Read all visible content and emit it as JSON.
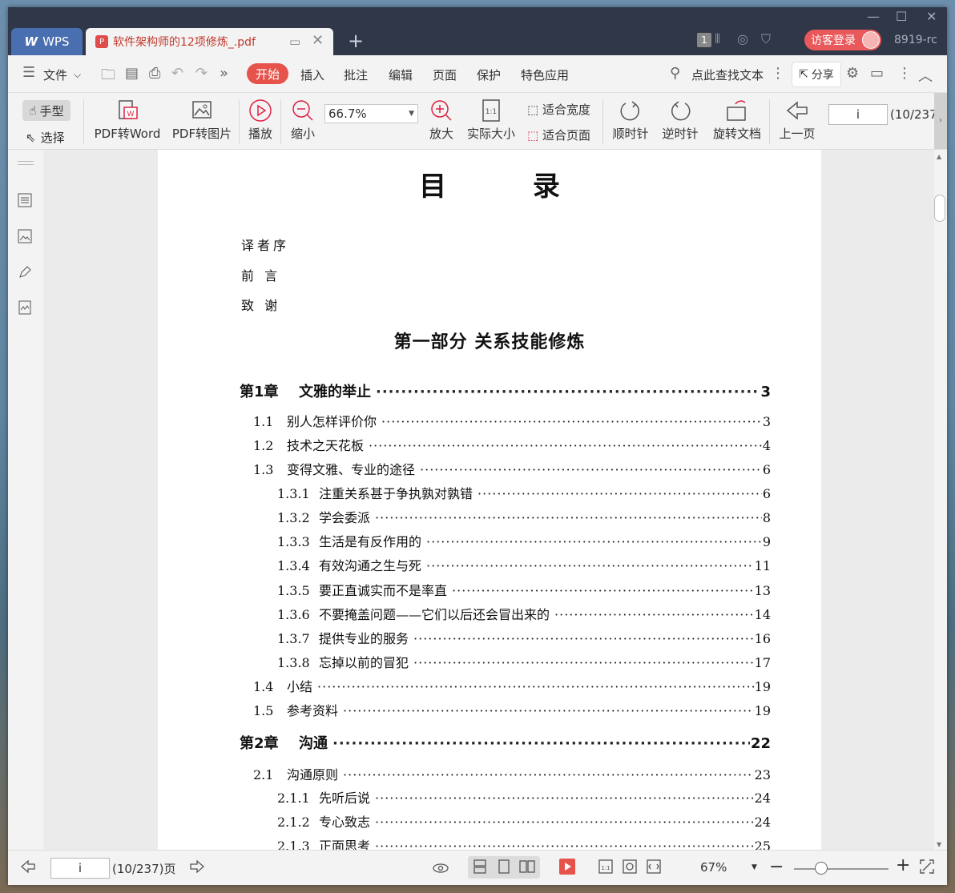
{
  "app": {
    "app_tab": "WPS",
    "doc_tab": "软件架构师的12项修炼_.pdf",
    "login": "访客登录",
    "version": "8919-rc",
    "window_count": "1"
  },
  "menu": {
    "file": "文件",
    "items": [
      "开始",
      "插入",
      "批注",
      "编辑",
      "页面",
      "保护",
      "特色应用"
    ],
    "search": "点此查找文本",
    "share": "分享"
  },
  "ribbon": {
    "hand": "手型",
    "select": "选择",
    "pdf_to_word": "PDF转Word",
    "pdf_to_image": "PDF转图片",
    "play": "播放",
    "zoom_out": "缩小",
    "zoom_value": "66.7%",
    "zoom_in": "放大",
    "actual_size": "实际大小",
    "fit_width": "适合宽度",
    "fit_page": "适合页面",
    "clockwise": "顺时针",
    "counterclockwise": "逆时针",
    "rotate_doc": "旋转文档",
    "prev_page": "上一页",
    "page_input": "i",
    "page_total": "(10/237"
  },
  "document": {
    "title": "目 录",
    "front_matter": [
      "译者序",
      "前 言",
      "致 谢"
    ],
    "part_title": "第一部分 关系技能修炼",
    "toc": [
      {
        "level": 1,
        "num": "第1章",
        "text": "文雅的举止",
        "page": "3"
      },
      {
        "level": 2,
        "num": "1.1",
        "text": "别人怎样评价你",
        "page": "3"
      },
      {
        "level": 2,
        "num": "1.2",
        "text": "技术之天花板",
        "page": "4"
      },
      {
        "level": 2,
        "num": "1.3",
        "text": "变得文雅、专业的途径",
        "page": "6"
      },
      {
        "level": 3,
        "num": "1.3.1",
        "text": "注重关系甚于争执孰对孰错",
        "page": "6"
      },
      {
        "level": 3,
        "num": "1.3.2",
        "text": "学会委派",
        "page": "8"
      },
      {
        "level": 3,
        "num": "1.3.3",
        "text": "生活是有反作用的",
        "page": "9"
      },
      {
        "level": 3,
        "num": "1.3.4",
        "text": "有效沟通之生与死",
        "page": "11"
      },
      {
        "level": 3,
        "num": "1.3.5",
        "text": "要正直诚实而不是率直",
        "page": "13"
      },
      {
        "level": 3,
        "num": "1.3.6",
        "text": "不要掩盖问题——它们以后还会冒出来的",
        "page": "14"
      },
      {
        "level": 3,
        "num": "1.3.7",
        "text": "提供专业的服务",
        "page": "16"
      },
      {
        "level": 3,
        "num": "1.3.8",
        "text": "忘掉以前的冒犯",
        "page": "17"
      },
      {
        "level": 2,
        "num": "1.4",
        "text": "小结",
        "page": "19"
      },
      {
        "level": 2,
        "num": "1.5",
        "text": "参考资料",
        "page": "19"
      },
      {
        "level": 1,
        "num": "第2章",
        "text": "沟通",
        "page": "22"
      },
      {
        "level": 2,
        "num": "2.1",
        "text": "沟通原则",
        "page": "23"
      },
      {
        "level": 3,
        "num": "2.1.1",
        "text": "先听后说",
        "page": "24"
      },
      {
        "level": 3,
        "num": "2.1.2",
        "text": "专心致志",
        "page": "24"
      },
      {
        "level": 3,
        "num": "2.1.3",
        "text": "正面思考",
        "page": "25"
      }
    ]
  },
  "status": {
    "page_input": "i",
    "page_total": "(10/237)页",
    "zoom": "67%"
  },
  "colors": {
    "accent": "#e5534b",
    "titlebar": "#2f3748",
    "wps_tab": "#4a6fb0"
  }
}
